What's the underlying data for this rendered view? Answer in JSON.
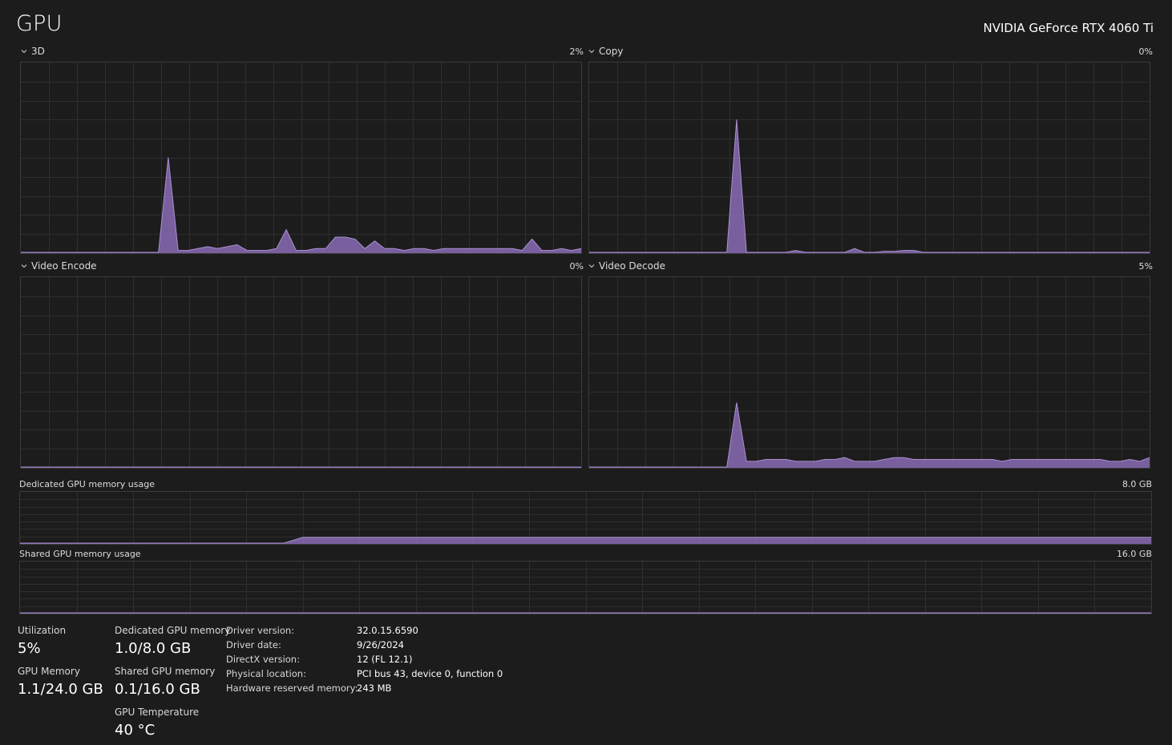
{
  "header": {
    "title": "GPU",
    "gpu_name": "NVIDIA GeForce RTX 4060 Ti"
  },
  "colors": {
    "background": "#1c1c1c",
    "grid": "#2e2e2e",
    "border": "#3a3a3a",
    "fill": "#8a6bb4",
    "stroke": "#a98fd0"
  },
  "engines": [
    {
      "label": "3D",
      "percent": "2%"
    },
    {
      "label": "Copy",
      "percent": "0%"
    },
    {
      "label": "Video Encode",
      "percent": "0%"
    },
    {
      "label": "Video Decode",
      "percent": "5%"
    }
  ],
  "memory": {
    "dedicated_label": "Dedicated GPU memory usage",
    "dedicated_capacity": "8.0 GB",
    "shared_label": "Shared GPU memory usage",
    "shared_capacity": "16.0 GB"
  },
  "stats": {
    "utilization_label": "Utilization",
    "utilization_value": "5%",
    "gpu_memory_label": "GPU Memory",
    "gpu_memory_value": "1.1/24.0 GB",
    "dedicated_label": "Dedicated GPU memory",
    "dedicated_value": "1.0/8.0 GB",
    "shared_label": "Shared GPU memory",
    "shared_value": "0.1/16.0 GB",
    "temp_label": "GPU Temperature",
    "temp_value": "40 °C"
  },
  "info": [
    {
      "label": "Driver version:",
      "value": "32.0.15.6590"
    },
    {
      "label": "Driver date:",
      "value": "9/26/2024"
    },
    {
      "label": "DirectX version:",
      "value": "12 (FL 12.1)"
    },
    {
      "label": "Physical location:",
      "value": "PCI bus 43, device 0, function 0"
    },
    {
      "label": "Hardware reserved memory:",
      "value": "243 MB"
    }
  ],
  "chart_data": [
    {
      "type": "area",
      "name": "3D",
      "ylim": [
        0,
        100
      ],
      "values": [
        0,
        0,
        0,
        0,
        0,
        0,
        0,
        0,
        0,
        0,
        0,
        0,
        0,
        0,
        0,
        50,
        1,
        1,
        2,
        3,
        2,
        3,
        4,
        1,
        1,
        1,
        2,
        12,
        1,
        1,
        2,
        2,
        8,
        8,
        7,
        2,
        6,
        2,
        2,
        1,
        2,
        2,
        1,
        2,
        2,
        2,
        2,
        2,
        2,
        2,
        2,
        1,
        7,
        1,
        1,
        2,
        1,
        2
      ]
    },
    {
      "type": "area",
      "name": "Copy",
      "ylim": [
        0,
        100
      ],
      "values": [
        0,
        0,
        0,
        0,
        0,
        0,
        0,
        0,
        0,
        0,
        0,
        0,
        0,
        0,
        0,
        70,
        0,
        0,
        0,
        0,
        0,
        1,
        0,
        0,
        0,
        0,
        0,
        2,
        0,
        0,
        0.5,
        0.5,
        1,
        1,
        0,
        0,
        0,
        0,
        0,
        0,
        0,
        0,
        0,
        0,
        0,
        0,
        0,
        0,
        0,
        0,
        0,
        0,
        0,
        0,
        0,
        0,
        0,
        0
      ]
    },
    {
      "type": "area",
      "name": "Video Encode",
      "ylim": [
        0,
        100
      ],
      "values": [
        0,
        0,
        0,
        0,
        0,
        0,
        0,
        0,
        0,
        0,
        0,
        0,
        0,
        0,
        0,
        0,
        0,
        0,
        0,
        0,
        0,
        0,
        0,
        0,
        0,
        0,
        0,
        0,
        0,
        0,
        0,
        0,
        0,
        0,
        0,
        0,
        0,
        0,
        0,
        0,
        0,
        0,
        0,
        0,
        0,
        0,
        0,
        0,
        0,
        0,
        0,
        0,
        0,
        0,
        0,
        0,
        0,
        0
      ]
    },
    {
      "type": "area",
      "name": "Video Decode",
      "ylim": [
        0,
        100
      ],
      "values": [
        0,
        0,
        0,
        0,
        0,
        0,
        0,
        0,
        0,
        0,
        0,
        0,
        0,
        0,
        0,
        34,
        3,
        3,
        4,
        4,
        4,
        3,
        3,
        3,
        4,
        4,
        5,
        3,
        3,
        3,
        4,
        5,
        5,
        4,
        4,
        4,
        4,
        4,
        4,
        4,
        4,
        4,
        3,
        4,
        4,
        4,
        4,
        4,
        4,
        4,
        4,
        4,
        4,
        3,
        3,
        4,
        3,
        5
      ]
    },
    {
      "type": "area",
      "name": "Dedicated GPU memory usage",
      "ylim": [
        0,
        8
      ],
      "values": [
        0,
        0,
        0,
        0,
        0,
        0,
        0,
        0,
        0,
        0,
        0,
        0,
        0,
        0,
        0,
        0.9,
        0.9,
        0.9,
        0.9,
        0.9,
        0.9,
        0.9,
        0.9,
        0.9,
        0.9,
        0.9,
        0.9,
        0.9,
        0.9,
        0.9,
        0.9,
        0.9,
        0.9,
        0.9,
        0.9,
        0.9,
        0.9,
        0.9,
        0.9,
        0.9,
        0.9,
        0.9,
        0.9,
        0.9,
        0.9,
        0.9,
        0.9,
        0.9,
        0.9,
        0.9,
        0.9,
        0.9,
        0.9,
        0.9,
        0.9,
        0.9,
        0.9,
        0.9,
        0.9,
        0.9,
        0.9
      ]
    },
    {
      "type": "area",
      "name": "Shared GPU memory usage",
      "ylim": [
        0,
        16
      ],
      "values": [
        0,
        0,
        0,
        0,
        0,
        0,
        0,
        0,
        0,
        0,
        0,
        0,
        0,
        0,
        0,
        0,
        0,
        0,
        0,
        0,
        0,
        0,
        0,
        0,
        0,
        0,
        0,
        0,
        0,
        0,
        0,
        0,
        0,
        0,
        0,
        0,
        0,
        0,
        0,
        0,
        0,
        0,
        0,
        0,
        0,
        0,
        0,
        0,
        0,
        0,
        0,
        0,
        0,
        0,
        0,
        0,
        0,
        0,
        0,
        0,
        0
      ]
    }
  ]
}
